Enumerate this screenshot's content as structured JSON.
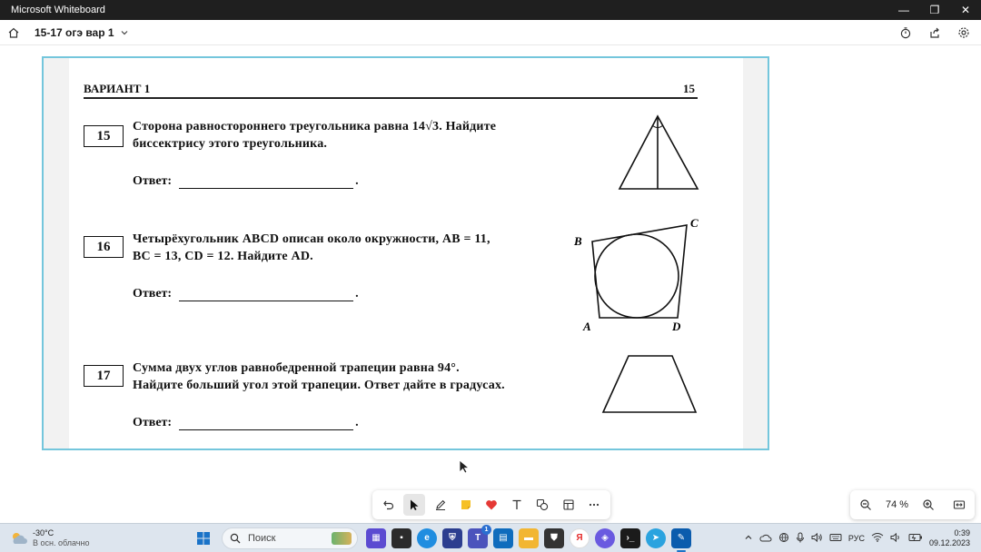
{
  "window": {
    "title": "Microsoft Whiteboard",
    "minimize": "—",
    "restore": "❐",
    "close": "✕"
  },
  "header": {
    "board_name": "15-17 огэ вар 1"
  },
  "sheet": {
    "variant": "ВАРИАНТ 1",
    "page_number": "15",
    "questions": [
      {
        "number": "15",
        "lines": [
          "Сторона равностороннего треугольника равна 14√3. Найдите",
          "биссектрису этого треугольника."
        ],
        "answer_label": "Ответ:",
        "answer_dot": "."
      },
      {
        "number": "16",
        "lines": [
          "Четырёхугольник ABCD описан около окружности, AB = 11,",
          "BC = 13, CD = 12. Найдите AD."
        ],
        "answer_label": "Ответ:",
        "answer_dot": "."
      },
      {
        "number": "17",
        "lines": [
          "Сумма двух углов равнобедренной трапеции равна 94°.",
          "Найдите больший угол этой трапеции. Ответ дайте в градусах."
        ],
        "answer_label": "Ответ:",
        "answer_dot": "."
      }
    ],
    "figure16_labels": {
      "a": "A",
      "b": "B",
      "c": "C",
      "d": "D"
    }
  },
  "zoom": {
    "level": "74 %"
  },
  "taskbar": {
    "weather_temp": "-30°C",
    "weather_desc": "В осн. облачно",
    "search_placeholder": "Поиск",
    "teams_badge": "1",
    "yandex_letter": "Я",
    "language": "РУС",
    "time": "0:39",
    "date": "09.12.2023"
  },
  "colors": {
    "titlebar": "#1f1f1f",
    "image_border": "#74c6dc",
    "taskbar": "#dde5ee",
    "heart": "#e53935",
    "sticky_note": "#f6c026"
  }
}
